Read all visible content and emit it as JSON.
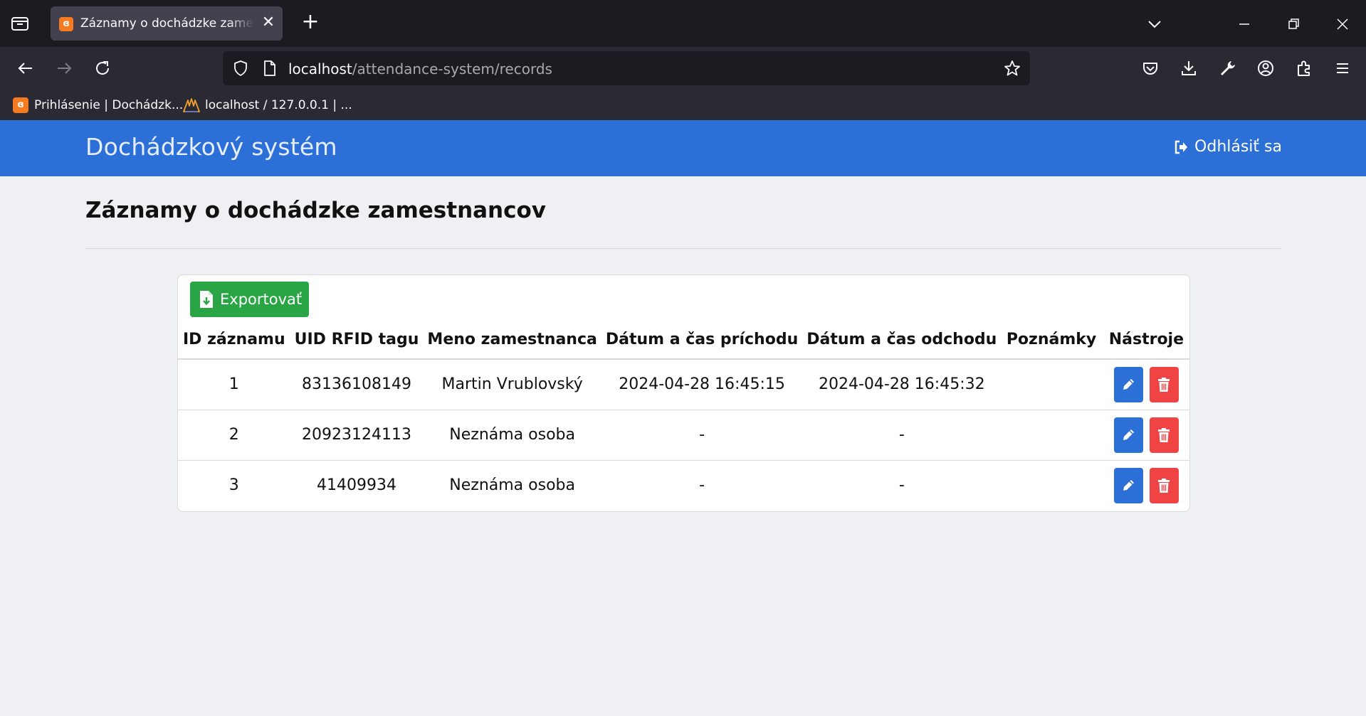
{
  "browser": {
    "tab_title": "Záznamy o dochádzke zamestnancov",
    "favicon_glyph": "ɞ",
    "close_glyph": "✕",
    "new_tab_glyph": "+",
    "url_host": "localhost",
    "url_path": "/attendance-system/records",
    "bookmarks": [
      {
        "label": "Prihlásenie | Dochádzk...",
        "icon": "xampp-icon"
      },
      {
        "label": "localhost / 127.0.0.1 | ...",
        "icon": "phpmyadmin-icon"
      }
    ]
  },
  "header": {
    "brand": "Dochádzkový systém",
    "logout_label": "Odhlásiť sa"
  },
  "main": {
    "title": "Záznamy o dochádzke zamestnancov",
    "export_label": "Exportovať",
    "table": {
      "headers": [
        "ID záznamu",
        "UID RFID tagu",
        "Meno zamestnanca",
        "Dátum a čas príchodu",
        "Dátum a čas odchodu",
        "Poznámky",
        "Nástroje"
      ],
      "rows": [
        [
          "1",
          "83136108149",
          "Martin Vrublovský",
          "2024-04-28 16:45:15",
          "2024-04-28 16:45:32",
          ""
        ],
        [
          "2",
          "20923124113",
          "Neznáma osoba",
          "-",
          "-",
          ""
        ],
        [
          "3",
          "41409934",
          "Neznáma osoba",
          "-",
          "-",
          ""
        ]
      ]
    }
  },
  "colors": {
    "header_blue": "#2c6fd6",
    "export_green": "#2aa545",
    "delete_red": "#f04444",
    "page_bg": "#eff0f4"
  }
}
